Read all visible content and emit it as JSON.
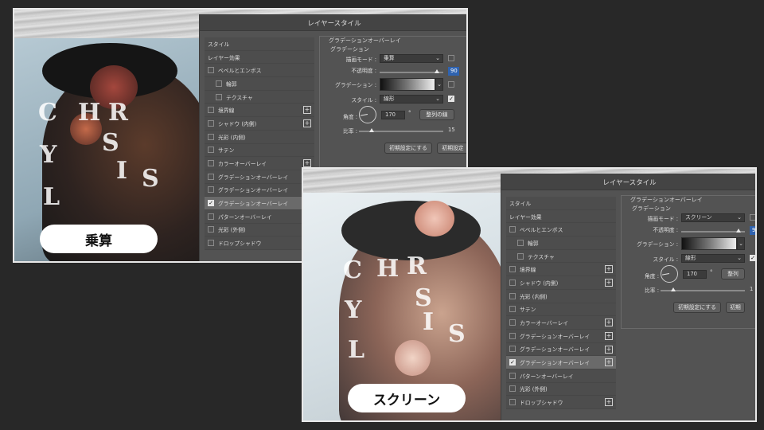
{
  "panels": [
    {
      "caption": "乗算",
      "dialog": {
        "title": "レイヤースタイル",
        "effects": [
          {
            "label": "スタイル",
            "checkbox": false,
            "checked": false,
            "plus": false,
            "selected": false,
            "indent": false
          },
          {
            "label": "レイヤー効果",
            "checkbox": false,
            "checked": false,
            "plus": false,
            "selected": false,
            "indent": false
          },
          {
            "label": "ベベルとエンボス",
            "checkbox": true,
            "checked": false,
            "plus": false,
            "selected": false,
            "indent": false
          },
          {
            "label": "輪郭",
            "checkbox": true,
            "checked": false,
            "plus": false,
            "selected": false,
            "indent": true
          },
          {
            "label": "テクスチャ",
            "checkbox": true,
            "checked": false,
            "plus": false,
            "selected": false,
            "indent": true
          },
          {
            "label": "境界線",
            "checkbox": true,
            "checked": false,
            "plus": true,
            "selected": false,
            "indent": false
          },
          {
            "label": "シャドウ (内側)",
            "checkbox": true,
            "checked": false,
            "plus": true,
            "selected": false,
            "indent": false
          },
          {
            "label": "光彩 (内側)",
            "checkbox": true,
            "checked": false,
            "plus": false,
            "selected": false,
            "indent": false
          },
          {
            "label": "サテン",
            "checkbox": true,
            "checked": false,
            "plus": false,
            "selected": false,
            "indent": false
          },
          {
            "label": "カラーオーバーレイ",
            "checkbox": true,
            "checked": false,
            "plus": true,
            "selected": false,
            "indent": false
          },
          {
            "label": "グラデーションオーバーレイ",
            "checkbox": true,
            "checked": false,
            "plus": true,
            "selected": false,
            "indent": false
          },
          {
            "label": "グラデーションオーバーレイ",
            "checkbox": true,
            "checked": false,
            "plus": true,
            "selected": false,
            "indent": false
          },
          {
            "label": "グラデーションオーバーレイ",
            "checkbox": true,
            "checked": true,
            "plus": true,
            "selected": true,
            "indent": false
          },
          {
            "label": "パターンオーバーレイ",
            "checkbox": true,
            "checked": false,
            "plus": false,
            "selected": false,
            "indent": false
          },
          {
            "label": "光彩 (外側)",
            "checkbox": true,
            "checked": false,
            "plus": false,
            "selected": false,
            "indent": false
          },
          {
            "label": "ドロップシャドウ",
            "checkbox": true,
            "checked": false,
            "plus": true,
            "selected": false,
            "indent": false
          }
        ],
        "settings": {
          "section_title": "グラデーションオーバーレイ",
          "subsection": "グラデーション",
          "blend_mode_label": "描画モード :",
          "blend_mode_value": "乗算",
          "opacity_label": "不透明度 :",
          "opacity_value": "90",
          "opacity_fraction": 0.9,
          "gradient_label": "グラデーション :",
          "style_label": "スタイル :",
          "style_value": "線形",
          "angle_label": "角度 :",
          "angle_value": "170",
          "angle_unit": "°",
          "scale_label": "比率 :",
          "scale_value": "15",
          "scale_fraction": 0.15,
          "align_button": "整列の線",
          "reset_button_1": "初期設定にする",
          "reset_button_2": "初期設定"
        }
      }
    },
    {
      "caption": "スクリーン",
      "dialog": {
        "title": "レイヤースタイル",
        "effects": [
          {
            "label": "スタイル",
            "checkbox": false,
            "checked": false,
            "plus": false,
            "selected": false,
            "indent": false
          },
          {
            "label": "レイヤー効果",
            "checkbox": false,
            "checked": false,
            "plus": false,
            "selected": false,
            "indent": false
          },
          {
            "label": "ベベルとエンボス",
            "checkbox": true,
            "checked": false,
            "plus": false,
            "selected": false,
            "indent": false
          },
          {
            "label": "輪郭",
            "checkbox": true,
            "checked": false,
            "plus": false,
            "selected": false,
            "indent": true
          },
          {
            "label": "テクスチャ",
            "checkbox": true,
            "checked": false,
            "plus": false,
            "selected": false,
            "indent": true
          },
          {
            "label": "境界線",
            "checkbox": true,
            "checked": false,
            "plus": true,
            "selected": false,
            "indent": false
          },
          {
            "label": "シャドウ (内側)",
            "checkbox": true,
            "checked": false,
            "plus": true,
            "selected": false,
            "indent": false
          },
          {
            "label": "光彩 (内側)",
            "checkbox": true,
            "checked": false,
            "plus": false,
            "selected": false,
            "indent": false
          },
          {
            "label": "サテン",
            "checkbox": true,
            "checked": false,
            "plus": false,
            "selected": false,
            "indent": false
          },
          {
            "label": "カラーオーバーレイ",
            "checkbox": true,
            "checked": false,
            "plus": true,
            "selected": false,
            "indent": false
          },
          {
            "label": "グラデーションオーバーレイ",
            "checkbox": true,
            "checked": false,
            "plus": true,
            "selected": false,
            "indent": false
          },
          {
            "label": "グラデーションオーバーレイ",
            "checkbox": true,
            "checked": false,
            "plus": true,
            "selected": false,
            "indent": false
          },
          {
            "label": "グラデーションオーバーレイ",
            "checkbox": true,
            "checked": true,
            "plus": true,
            "selected": true,
            "indent": false
          },
          {
            "label": "パターンオーバーレイ",
            "checkbox": true,
            "checked": false,
            "plus": false,
            "selected": false,
            "indent": false
          },
          {
            "label": "光彩 (外側)",
            "checkbox": true,
            "checked": false,
            "plus": false,
            "selected": false,
            "indent": false
          },
          {
            "label": "ドロップシャドウ",
            "checkbox": true,
            "checked": false,
            "plus": true,
            "selected": false,
            "indent": false
          }
        ],
        "settings": {
          "section_title": "グラデーションオーバーレイ",
          "subsection": "グラデーション",
          "blend_mode_label": "描画モード :",
          "blend_mode_value": "スクリーン",
          "opacity_label": "不透明度 :",
          "opacity_value": "9",
          "opacity_fraction": 0.9,
          "gradient_label": "グラデーション :",
          "style_label": "スタイル :",
          "style_value": "線形",
          "angle_label": "角度 :",
          "angle_value": "170",
          "angle_unit": "°",
          "scale_label": "比率 :",
          "scale_value": "1",
          "scale_fraction": 0.15,
          "align_button": "整列",
          "reset_button_1": "初期設定にする",
          "reset_button_2": "初期"
        }
      }
    }
  ],
  "magazine_letters": [
    "C",
    "H",
    "R",
    "Y",
    "S",
    "L",
    "I",
    "S"
  ]
}
